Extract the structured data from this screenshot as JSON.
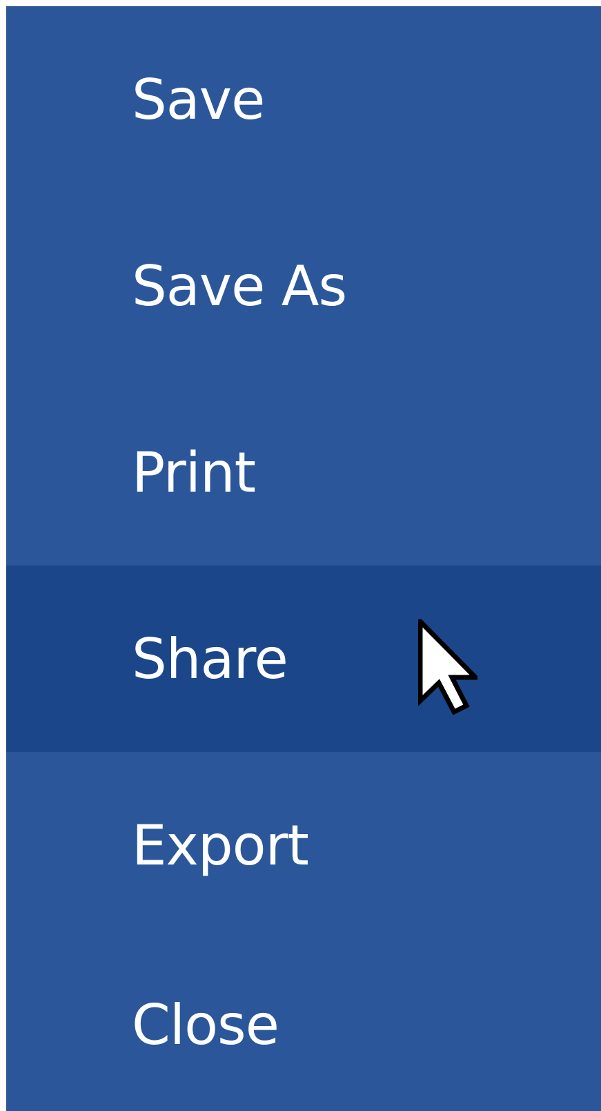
{
  "file_menu": {
    "items": [
      {
        "label": "Save"
      },
      {
        "label": "Save As"
      },
      {
        "label": "Print"
      },
      {
        "label": "Share",
        "hovered": true
      },
      {
        "label": "Export"
      },
      {
        "label": "Close"
      }
    ]
  },
  "colors": {
    "menu_background": "#2b579a",
    "hover_background": "#1b4689",
    "text": "#ffffff"
  },
  "icons": {
    "cursor": "mouse-pointer-icon"
  }
}
